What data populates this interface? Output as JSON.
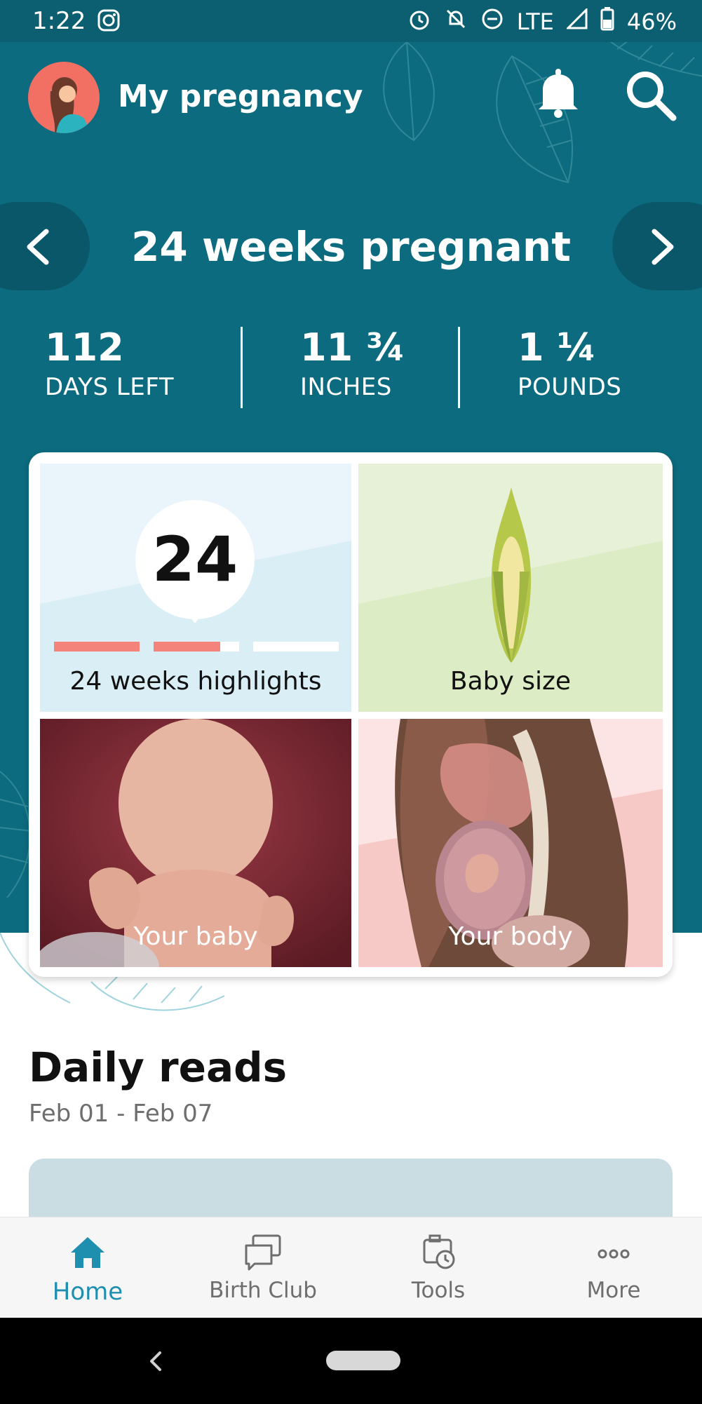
{
  "status": {
    "time": "1:22",
    "network": "LTE",
    "battery": "46%"
  },
  "header": {
    "title": "My pregnancy"
  },
  "week": {
    "title": "24 weeks pregnant"
  },
  "stats": [
    {
      "value": "112",
      "label": "DAYS LEFT"
    },
    {
      "value": "11 ¾",
      "label": "INCHES"
    },
    {
      "value": "1 ¼",
      "label": "POUNDS"
    }
  ],
  "tiles": {
    "highlights": {
      "number": "24",
      "label": "24 weeks highlights"
    },
    "size": {
      "label": "Baby size"
    },
    "baby": {
      "label": "Your baby"
    },
    "body": {
      "label": "Your body"
    }
  },
  "daily_reads": {
    "title": "Daily reads",
    "date_range": "Feb 01 - Feb 07"
  },
  "bottom_nav": [
    {
      "label": "Home",
      "active": true
    },
    {
      "label": "Birth Club",
      "active": false
    },
    {
      "label": "Tools",
      "active": false
    },
    {
      "label": "More",
      "active": false
    }
  ],
  "colors": {
    "primary": "#0c6b7e",
    "accent": "#1f8fb0",
    "progress": "#f4837b"
  }
}
